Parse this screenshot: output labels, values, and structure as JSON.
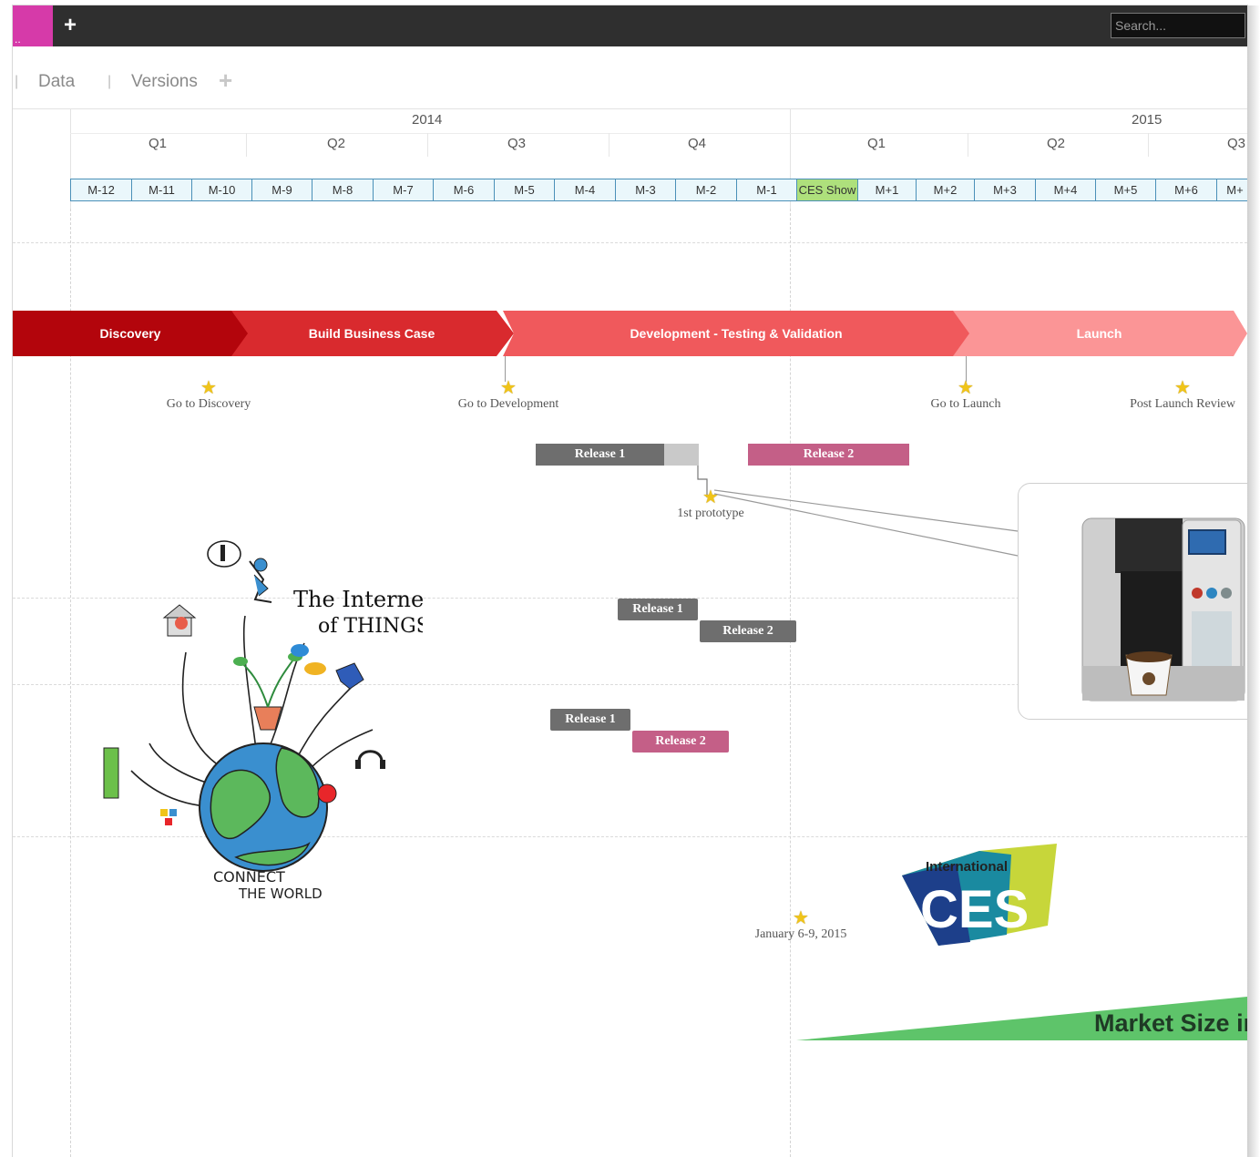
{
  "app": {
    "active_tab_label": "..",
    "add_tab_icon": "plus-icon",
    "search_placeholder": "Search..."
  },
  "nav": {
    "tabs": [
      "Data",
      "Versions"
    ],
    "add_icon": "plus-icon"
  },
  "timeline": {
    "years": [
      "2014",
      "2015"
    ],
    "quarters": [
      "Q1",
      "Q2",
      "Q3",
      "Q4",
      "Q1",
      "Q2",
      "Q3"
    ],
    "months": [
      "M-12",
      "M-11",
      "M-10",
      "M-9",
      "M-8",
      "M-7",
      "M-6",
      "M-5",
      "M-4",
      "M-3",
      "M-2",
      "M-1",
      "CES Show",
      "M+1",
      "M+2",
      "M+3",
      "M+4",
      "M+5",
      "M+6",
      "M+"
    ],
    "highlighted_month": "CES Show",
    "highlight_color": "#aee07c"
  },
  "phases": [
    {
      "label": "Discovery",
      "color": "#b3050c"
    },
    {
      "label": "Build Business Case",
      "color": "#d92a2e"
    },
    {
      "label": "Development - Testing & Validation",
      "color": "#f0595c"
    },
    {
      "label": "Launch",
      "color": "#fb9596"
    }
  ],
  "milestones": [
    {
      "label": "Go to Discovery",
      "icon": "star-icon"
    },
    {
      "label": "Go to Development",
      "icon": "star-icon"
    },
    {
      "label": "Go to Launch",
      "icon": "star-icon"
    },
    {
      "label": "Post Launch Review",
      "icon": "star-icon"
    },
    {
      "label": "1st prototype",
      "icon": "star-icon"
    },
    {
      "label": "January 6-9, 2015",
      "icon": "star-icon"
    }
  ],
  "releases": {
    "row1": [
      "Release 1",
      "Release 2"
    ],
    "row2": [
      "Release 1",
      "Release 2"
    ],
    "row3": [
      "Release 1",
      "Release 2"
    ]
  },
  "images": {
    "iot": {
      "title_line1": "The Internet",
      "title_line2": "of THINGS",
      "footer_line1": "CONNECT",
      "footer_line2": "THE WORLD"
    },
    "product": "coffee-machine-image",
    "ces_logo": {
      "top": "International",
      "main": "CES"
    }
  },
  "market": {
    "label": "Market Size in",
    "color": "#5ec46a"
  },
  "colors": {
    "gray_release": "#6e6e6e",
    "pink_release": "#c45f87",
    "topbar": "#2f2f2f",
    "active_tab": "#d63aa9"
  }
}
